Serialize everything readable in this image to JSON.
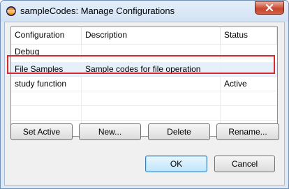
{
  "window": {
    "title": "sampleCodes: Manage Configurations",
    "app_icon": "eclipse-icon",
    "close_icon": "close-icon"
  },
  "table": {
    "columns": [
      "Configuration",
      "Description",
      "Status"
    ],
    "rows": [
      {
        "configuration": "Debug",
        "description": "",
        "status": ""
      },
      {
        "configuration": "File Samples",
        "description": "Sample codes for file operation",
        "status": ""
      },
      {
        "configuration": "study function",
        "description": "",
        "status": "Active"
      }
    ],
    "highlighted_row": "File Samples"
  },
  "buttons": {
    "set_active": "Set Active",
    "new": "New...",
    "delete": "Delete",
    "rename": "Rename...",
    "ok": "OK",
    "cancel": "Cancel"
  },
  "colors": {
    "highlight_border": "#d9272e",
    "close_button": "#c7462f"
  }
}
